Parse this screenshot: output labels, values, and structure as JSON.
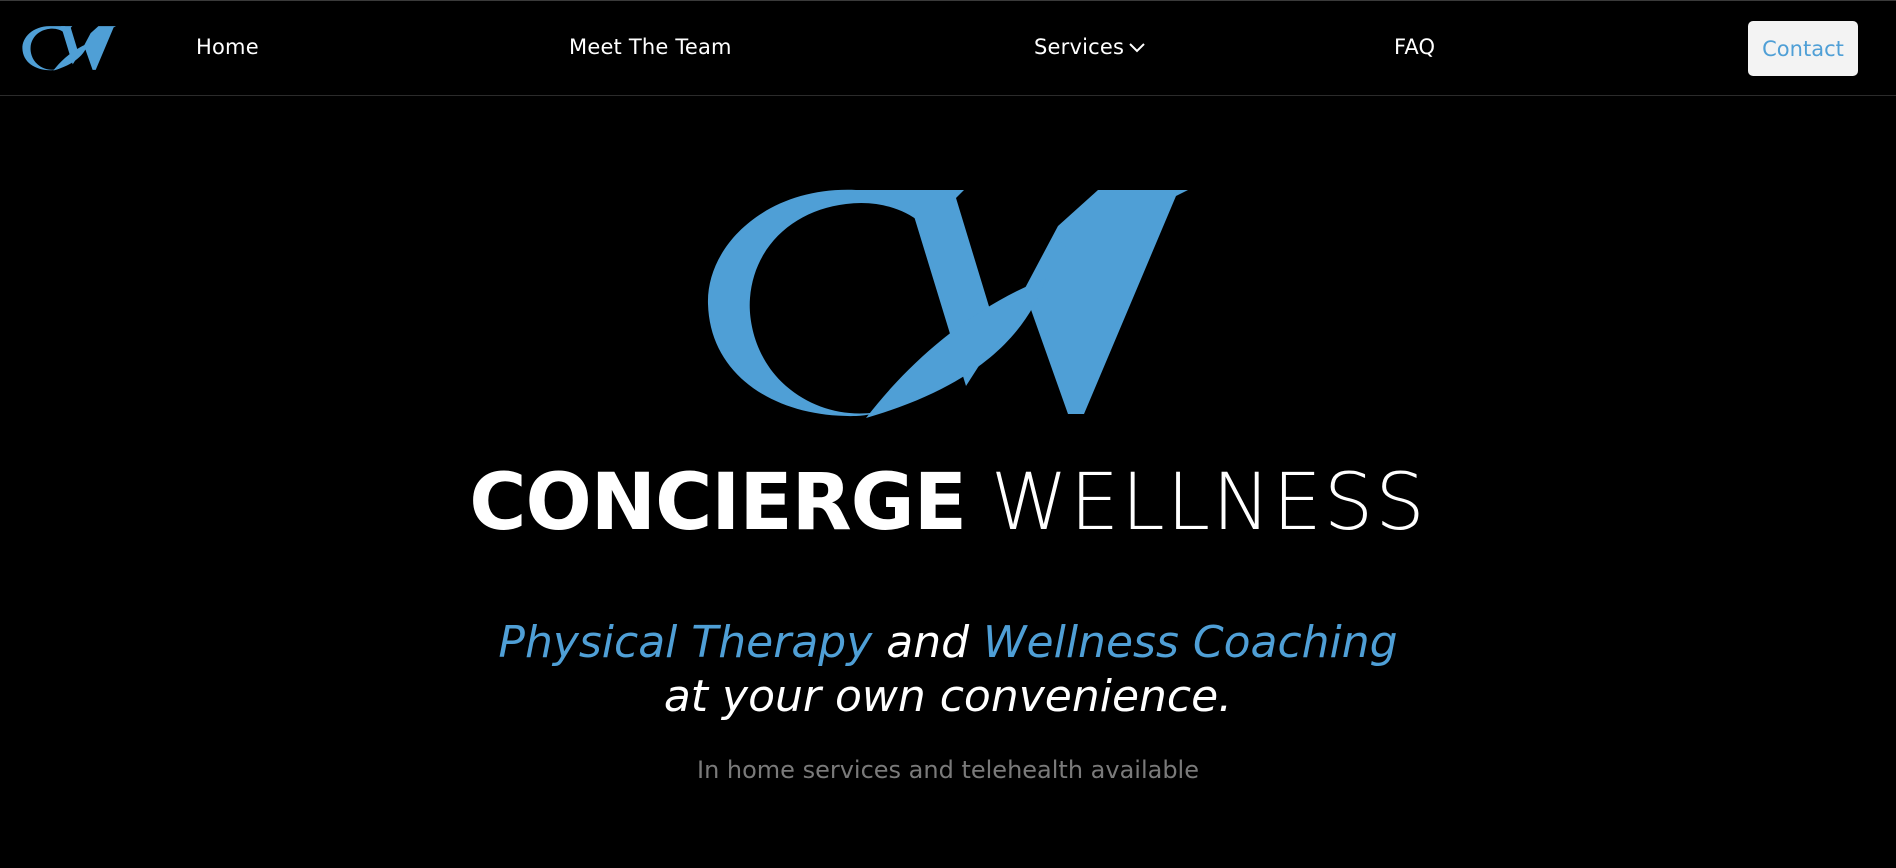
{
  "nav": {
    "logo_icon": "cw-monogram-icon",
    "home_label": "Home",
    "team_label": "Meet The Team",
    "services_label": "Services",
    "services_icon": "chevron-down-icon",
    "faq_label": "FAQ",
    "contact_label": "Contact"
  },
  "hero": {
    "logo_icon": "cw-monogram-icon",
    "brand_bold": "CONCIERGE",
    "brand_light": "WELLNESS",
    "tagline_part1": "Physical Therapy",
    "tagline_part2": "and",
    "tagline_part3": "Wellness Coaching",
    "tagline_line2": "at your own convenience.",
    "subtext": "In home services and telehealth available"
  },
  "colors": {
    "background": "#000000",
    "accent": "#4f9fd6",
    "text": "#ffffff",
    "muted": "#7a7a7a",
    "button_bg": "#f3f3f3"
  }
}
